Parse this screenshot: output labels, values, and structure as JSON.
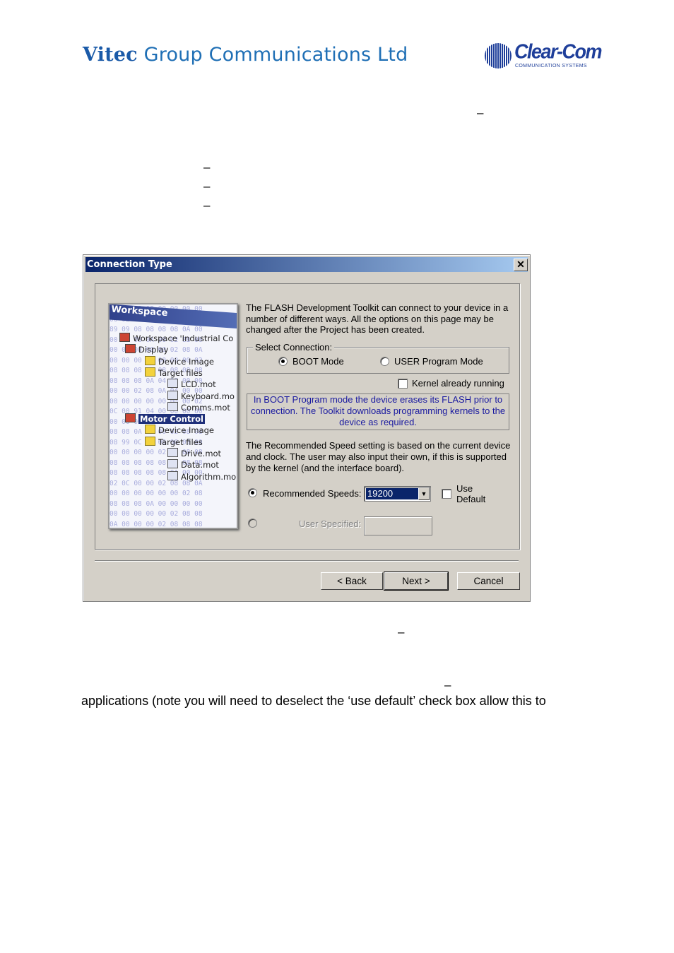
{
  "header": {
    "company_brand": "Vitec",
    "company_rest": "Group Communications Ltd",
    "logo_name": "Clear-Com",
    "logo_tagline": "COMMUNICATION SYSTEMS"
  },
  "body": {
    "dash": "–",
    "last_line": "applications (note you will need to deselect the ‘use default’ check box allow this to"
  },
  "dialog": {
    "title": "Connection Type",
    "close_glyph": "✕",
    "workspace_image": {
      "bar_title": "Workspace",
      "tree": [
        {
          "label": "Workspace 'Industrial Co",
          "icon": "workspace-icon"
        },
        {
          "label": "Display",
          "icon": "project-icon"
        },
        {
          "label": "Device Image",
          "icon": "folder-icon"
        },
        {
          "label": "Target files",
          "icon": "folder-icon"
        },
        {
          "label": "LCD.mot",
          "icon": "s-file-icon"
        },
        {
          "label": "Keyboard.mo",
          "icon": "s-file-icon"
        },
        {
          "label": "Comms.mot",
          "icon": "s-file-icon"
        },
        {
          "label": "Motor Control",
          "icon": "project-icon",
          "selected": true
        },
        {
          "label": "Device Image",
          "icon": "folder-icon"
        },
        {
          "label": "Target files",
          "icon": "folder-icon"
        },
        {
          "label": "Drive.mot",
          "icon": "s-file-icon"
        },
        {
          "label": "Data.mot",
          "icon": "s-file-icon"
        },
        {
          "label": "Algorithm.mo",
          "icon": "s-file-icon"
        }
      ]
    },
    "intro": [
      "The FLASH Development Toolkit can connect to your device in a",
      "number of different ways. All the options on this page may be",
      "changed after the Project has been created."
    ],
    "select_connection_label": "Select Connection:",
    "boot_mode": {
      "label": "BOOT Mode",
      "selected": true
    },
    "user_mode": {
      "label": "USER Program Mode",
      "selected": false
    },
    "kernel_running": {
      "label": "Kernel already running",
      "checked": false
    },
    "info": [
      "In BOOT Program mode the device erases its FLASH prior to",
      "connection. The Toolkit downloads programming kernels to the",
      "device as required."
    ],
    "speed_text": [
      "The Recommended Speed setting is based on the current device",
      "and clock. The user may also input their own, if this is supported",
      "by the kernel (and the interface board)."
    ],
    "recommended": {
      "label": "Recommended Speeds:",
      "value": "19200",
      "selected": true
    },
    "use_default": {
      "label1": "Use",
      "label2": "Default",
      "checked": false
    },
    "user_specified": {
      "label": "User Specified:",
      "value": "",
      "enabled": false
    },
    "buttons": {
      "back": "< Back",
      "next": "Next >",
      "cancel": "Cancel"
    }
  },
  "colors": {
    "titlebar_start": "#0a246a",
    "titlebar_end": "#a6caf0",
    "info_text": "#1a1aa0",
    "brand_blue": "#1f6fb5"
  }
}
